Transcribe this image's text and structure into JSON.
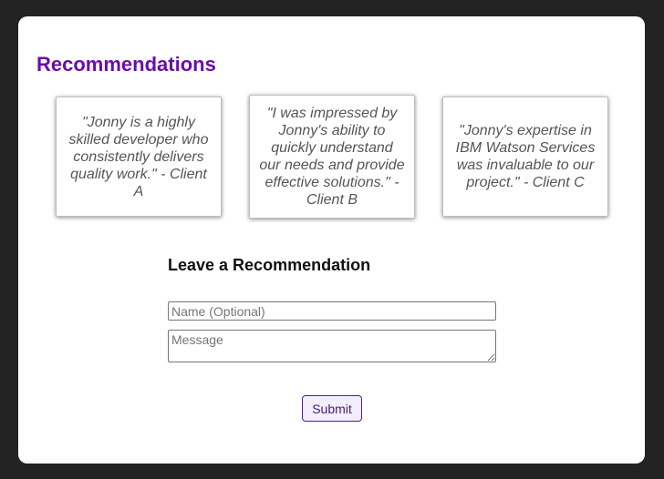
{
  "recommendations": {
    "title": "Recommendations",
    "items": [
      {
        "text": "\"Jonny is a highly skilled developer who consistently delivers quality work.\" - Client A"
      },
      {
        "text": "\"I was impressed by Jonny's ability to quickly understand our needs and provide effective solutions.\" - Client B"
      },
      {
        "text": "\"Jonny's expertise in IBM Watson Services was invaluable to our project.\" - Client C"
      }
    ]
  },
  "form": {
    "title": "Leave a Recommendation",
    "name_placeholder": "Name (Optional)",
    "name_value": "",
    "message_placeholder": "Message",
    "message_value": "",
    "submit_label": "Submit"
  },
  "colors": {
    "background": "#232323",
    "card": "#ffffff",
    "accent": "#6a0dad",
    "quote_text": "#555555"
  }
}
